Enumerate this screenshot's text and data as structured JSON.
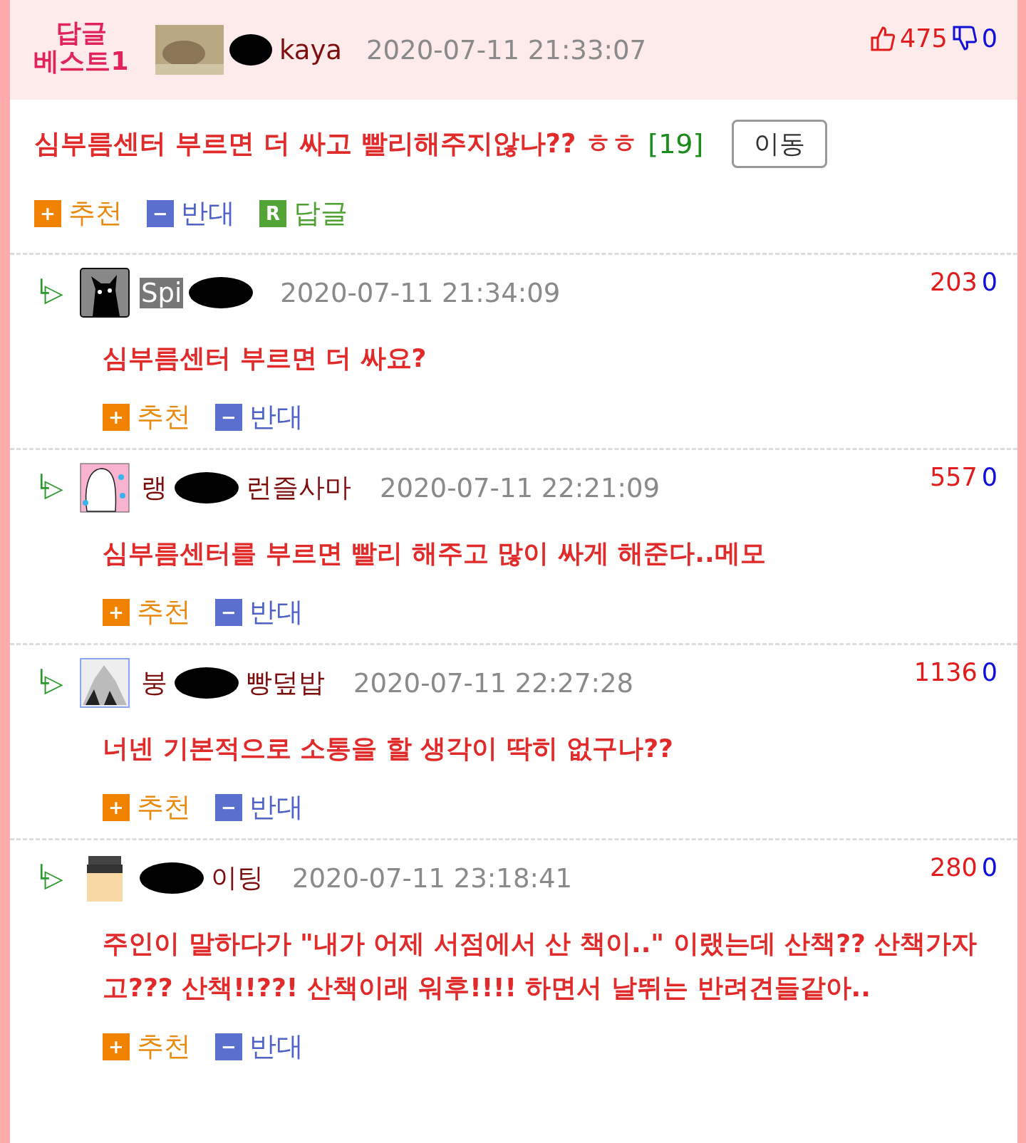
{
  "best_post": {
    "badge": "답글\n베스트1",
    "avatar": {
      "kind": "photo"
    },
    "name_end": "kaya",
    "time": "2020-07-11 21:33:07",
    "up": "475",
    "down": "0",
    "title": "심부름센터 부르면 더 싸고 빨리해주지않나?? ㅎㅎ",
    "reply_count": "[19]",
    "move_button": "이동",
    "actions": [
      {
        "kind": "plus",
        "icon": "+",
        "label": "추천"
      },
      {
        "kind": "minus",
        "icon": "−",
        "label": "반대"
      },
      {
        "kind": "reply",
        "icon": "R",
        "label": "답글"
      }
    ]
  },
  "comments": [
    {
      "reply_icon": "└▷",
      "avatar": {
        "kind": "cat"
      },
      "name_start": "Spi",
      "highlighted": true,
      "time": "2020-07-11 21:34:09",
      "up": "203",
      "down": "0",
      "text": "심부름센터 부르면 더 싸요?",
      "actions": [
        {
          "kind": "plus",
          "icon": "+",
          "label": "추천"
        },
        {
          "kind": "minus",
          "icon": "−",
          "label": "반대"
        }
      ]
    },
    {
      "reply_icon": "└▷",
      "avatar": {
        "kind": "sketch"
      },
      "name_start": "랭",
      "name_end": "런즐사마",
      "highlighted": false,
      "time": "2020-07-11 22:21:09",
      "up": "557",
      "down": "0",
      "text": "심부름센터를 부르면 빨리 해주고 많이 싸게 해준다..메모",
      "actions": [
        {
          "kind": "plus",
          "icon": "+",
          "label": "추천"
        },
        {
          "kind": "minus",
          "icon": "−",
          "label": "반대"
        }
      ]
    },
    {
      "reply_icon": "└▷",
      "avatar": {
        "kind": "mountain"
      },
      "name_start": "붕",
      "name_end": "빵덮밥",
      "highlighted": false,
      "time": "2020-07-11 22:27:28",
      "up": "1136",
      "down": "0",
      "text": "너넨 기본적으로 소통을 할 생각이 딱히 없구나??",
      "actions": [
        {
          "kind": "plus",
          "icon": "+",
          "label": "추천"
        },
        {
          "kind": "minus",
          "icon": "−",
          "label": "반대"
        }
      ]
    },
    {
      "reply_icon": "└▷",
      "avatar": {
        "kind": "figure"
      },
      "name_end": "이팅",
      "highlighted": false,
      "time": "2020-07-11 23:18:41",
      "up": "280",
      "down": "0",
      "text": "주인이 말하다가 \"내가 어제 서점에서 산 책이..\" 이랬는데 산책?? 산책가자 고??? 산책!!??! 산책이래 워후!!!! 하면서 날뛰는 반려견들같아..",
      "actions": [
        {
          "kind": "plus",
          "icon": "+",
          "label": "추천"
        },
        {
          "kind": "minus",
          "icon": "−",
          "label": "반대"
        }
      ]
    }
  ]
}
